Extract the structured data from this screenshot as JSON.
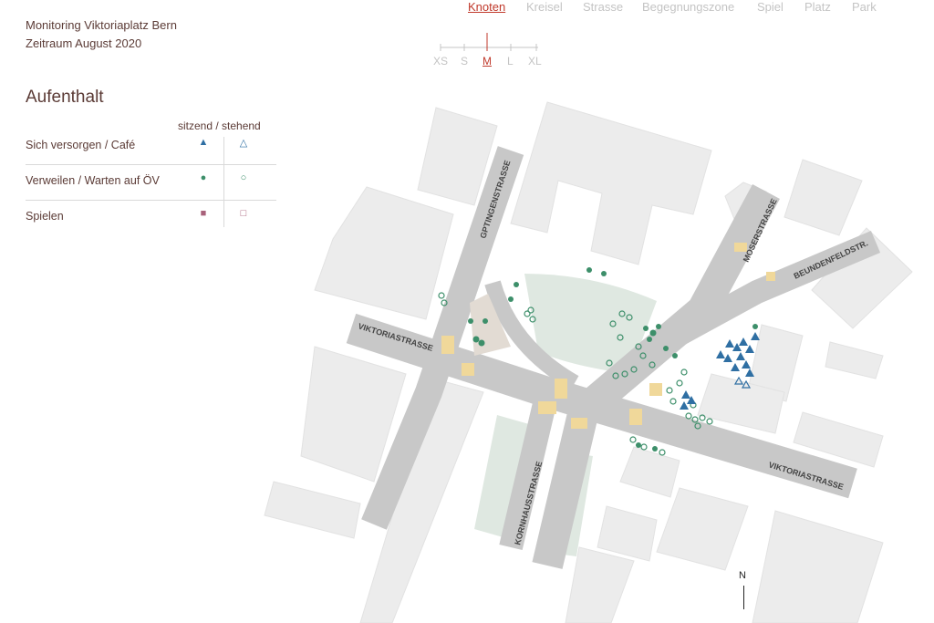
{
  "header": {
    "title_line1": "Monitoring Viktoriaplatz Bern",
    "title_line2": "Zeitraum August 2020"
  },
  "nav": {
    "categories": [
      "Knoten",
      "Kreisel",
      "Strasse",
      "Begegnungszone",
      "Spiel",
      "Platz",
      "Park"
    ],
    "active_category": "Knoten",
    "sizes": [
      "XS",
      "S",
      "M",
      "L",
      "XL"
    ],
    "active_size": "M"
  },
  "legend": {
    "section_title": "Aufenthalt",
    "column_header": "sitzend / stehend",
    "rows": [
      {
        "label": "Sich versorgen / Café",
        "sitting_symbol": "▲",
        "standing_symbol": "△",
        "color": "#2f6fa3"
      },
      {
        "label": "Verweilen / Warten auf ÖV",
        "sitting_symbol": "●",
        "standing_symbol": "○",
        "color": "#3d8f6a"
      },
      {
        "label": "Spielen",
        "sitting_symbol": "■",
        "standing_symbol": "□",
        "color": "#a8617a"
      }
    ]
  },
  "map": {
    "street_labels": [
      "VIKTORIASTRASSE",
      "GPTINGENSTRASSE",
      "MOSERSTRASSE",
      "BEUNDENFELDSTR.",
      "VIKTORIASTRASSE",
      "KORNHAUSSTRASSE"
    ],
    "north_label": "N",
    "colors": {
      "road": "#c8c8c8",
      "building": "#ececec",
      "green": "#dfe8e1",
      "crosswalk": "#f0d89a",
      "cafe": "#2f6fa3",
      "waiting": "#3d8f6a",
      "play": "#a8617a"
    }
  }
}
